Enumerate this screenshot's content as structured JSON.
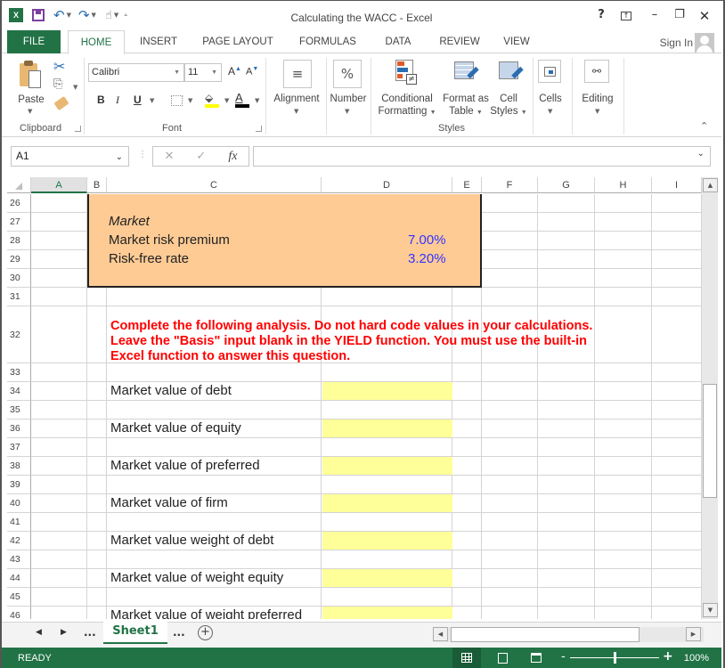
{
  "window": {
    "title": "Calculating the WACC - Excel",
    "help_label": "?",
    "controls": [
      "ribbon-display-options",
      "minimize",
      "restore",
      "close"
    ]
  },
  "quick_access": {
    "icons": [
      "excel-logo-icon",
      "save-icon",
      "undo-icon",
      "redo-icon",
      "touch-mode-icon",
      "customize-qat-icon"
    ]
  },
  "tabs": {
    "file": "FILE",
    "items": [
      "HOME",
      "INSERT",
      "PAGE LAYOUT",
      "FORMULAS",
      "DATA",
      "REVIEW",
      "VIEW"
    ],
    "active": "HOME",
    "sign_in": "Sign In"
  },
  "ribbon": {
    "clipboard": {
      "label": "Clipboard",
      "paste": "Paste"
    },
    "font": {
      "label": "Font",
      "name": "Calibri",
      "size": "11",
      "bold": "B",
      "italic": "I",
      "underline": "U",
      "fill_color": "#ffff00",
      "font_color": "#000000"
    },
    "alignment": {
      "label": "Alignment"
    },
    "number": {
      "label": "Number",
      "icon_text": "%"
    },
    "styles": {
      "label": "Styles",
      "conditional_line1": "Conditional",
      "conditional_line2": "Formatting",
      "format_table_line1": "Format as",
      "format_table_line2": "Table",
      "cell_styles_line1": "Cell",
      "cell_styles_line2": "Styles"
    },
    "cells": {
      "label": "Cells"
    },
    "editing": {
      "label": "Editing"
    }
  },
  "formula_bar": {
    "name_box": "A1",
    "formula": "",
    "fx_label": "fx"
  },
  "grid": {
    "columns": [
      "A",
      "B",
      "C",
      "D",
      "E",
      "F",
      "G",
      "H",
      "I"
    ],
    "selected_column": "A",
    "rows": [
      "26",
      "27",
      "28",
      "29",
      "30",
      "31",
      "32",
      "33",
      "34",
      "35",
      "36",
      "37",
      "38",
      "39",
      "40",
      "41",
      "42",
      "43",
      "44",
      "45",
      "46"
    ],
    "market_section": {
      "heading": "Market",
      "items": [
        {
          "label": "Market risk premium",
          "value": "7.00%"
        },
        {
          "label": "Risk-free rate",
          "value": "3.20%"
        }
      ],
      "fill_color": "#fecb95",
      "value_color": "#3333ff"
    },
    "instructions": {
      "line1": "Complete the following analysis. Do not hard code values in your calculations.",
      "line2": "Leave the \"Basis\" input blank in the YIELD function. You must use the built-in",
      "line3": "Excel function to answer this question.",
      "color": "#ff0000"
    },
    "analysis_rows": [
      {
        "row": "34",
        "label": "Market value of debt",
        "value": ""
      },
      {
        "row": "36",
        "label": "Market value of equity",
        "value": ""
      },
      {
        "row": "38",
        "label": "Market value of preferred",
        "value": ""
      },
      {
        "row": "40",
        "label": "Market value of firm",
        "value": ""
      },
      {
        "row": "42",
        "label": "Market value weight of debt",
        "value": ""
      },
      {
        "row": "44",
        "label": "Market value of weight equity",
        "value": ""
      },
      {
        "row": "46",
        "label": "Market value of weight preferred",
        "value": ""
      }
    ],
    "input_fill_color": "#ffff99"
  },
  "sheet_tabs": {
    "ellipsis_left": "...",
    "active": "Sheet1",
    "ellipsis_right": "...",
    "add_label": "+"
  },
  "status_bar": {
    "status": "READY",
    "zoom": "100%",
    "zoom_percent": 100
  }
}
